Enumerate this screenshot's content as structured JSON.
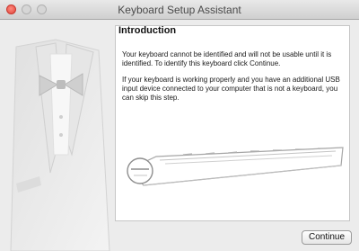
{
  "window": {
    "title": "Keyboard Setup Assistant"
  },
  "main": {
    "heading": "Introduction",
    "paragraph1": "Your keyboard cannot be identified and will not be usable until it is identified. To identify this keyboard click Continue.",
    "paragraph2": "If your keyboard is working properly and you have an additional USB input device connected to your computer that is not a keyboard, you can skip this step."
  },
  "footer": {
    "continue_label": "Continue"
  },
  "icons": {
    "close": "close-icon",
    "minimize": "minimize-icon",
    "zoom": "zoom-icon",
    "tuxedo": "tuxedo-icon",
    "keyboard": "keyboard-icon"
  },
  "colors": {
    "close_button": "#e0443a",
    "window_bg": "#ececec",
    "pane_bg": "#ffffff"
  }
}
